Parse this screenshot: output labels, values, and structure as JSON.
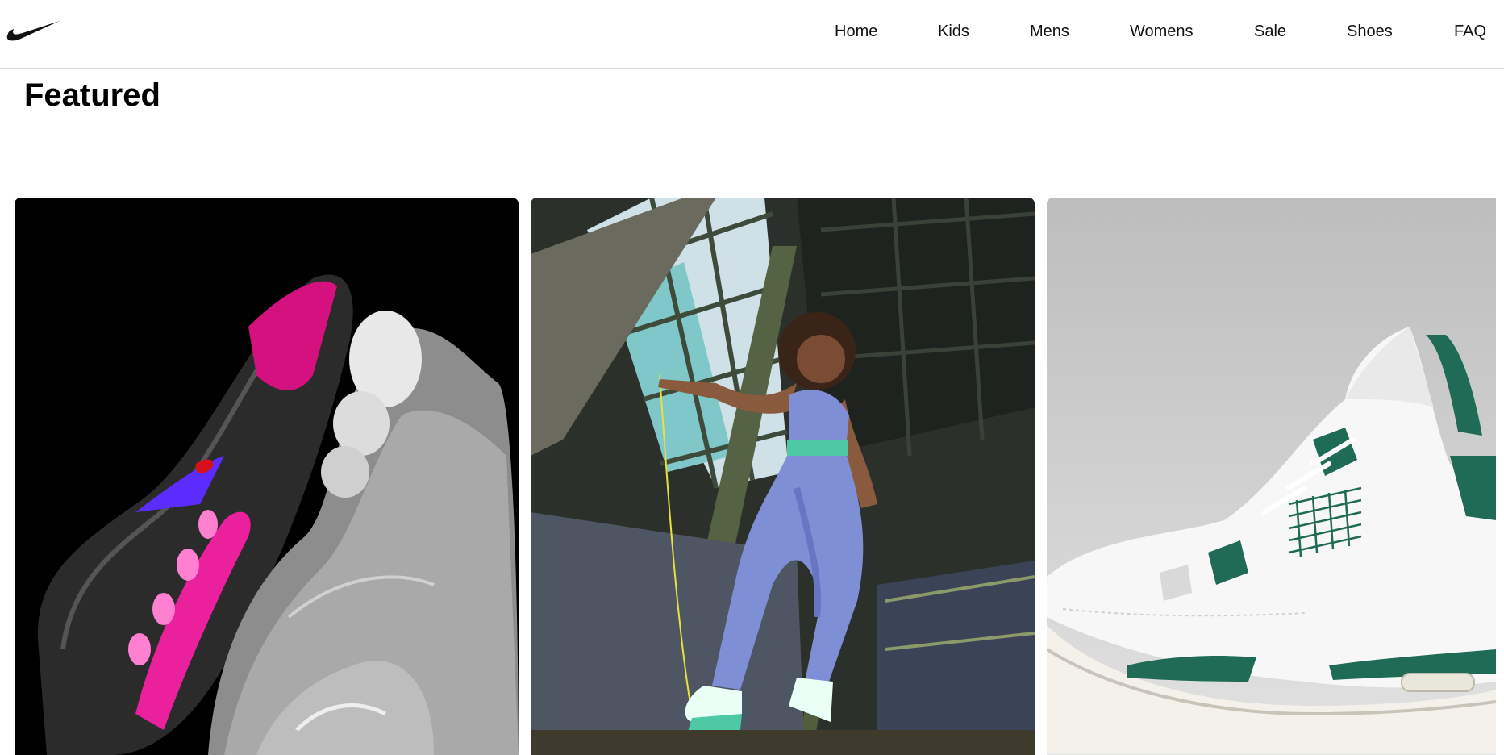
{
  "brand": {
    "logo_icon": "swoosh-icon"
  },
  "nav": {
    "items": [
      {
        "label": "Home"
      },
      {
        "label": "Kids"
      },
      {
        "label": "Mens"
      },
      {
        "label": "Womens"
      },
      {
        "label": "Sale"
      },
      {
        "label": "Shoes"
      },
      {
        "label": "FAQ"
      }
    ]
  },
  "main": {
    "title": "Featured",
    "cards": [
      {
        "image": "black-and-pink-air-sneakers"
      },
      {
        "image": "woman-jumping-rope-in-warehouse"
      },
      {
        "image": "white-and-green-basketball-sneaker"
      }
    ]
  },
  "colors": {
    "accent_pink": "#ff1fa8",
    "accent_green": "#1f6b55",
    "leggings_blue": "#7f8fd6"
  }
}
